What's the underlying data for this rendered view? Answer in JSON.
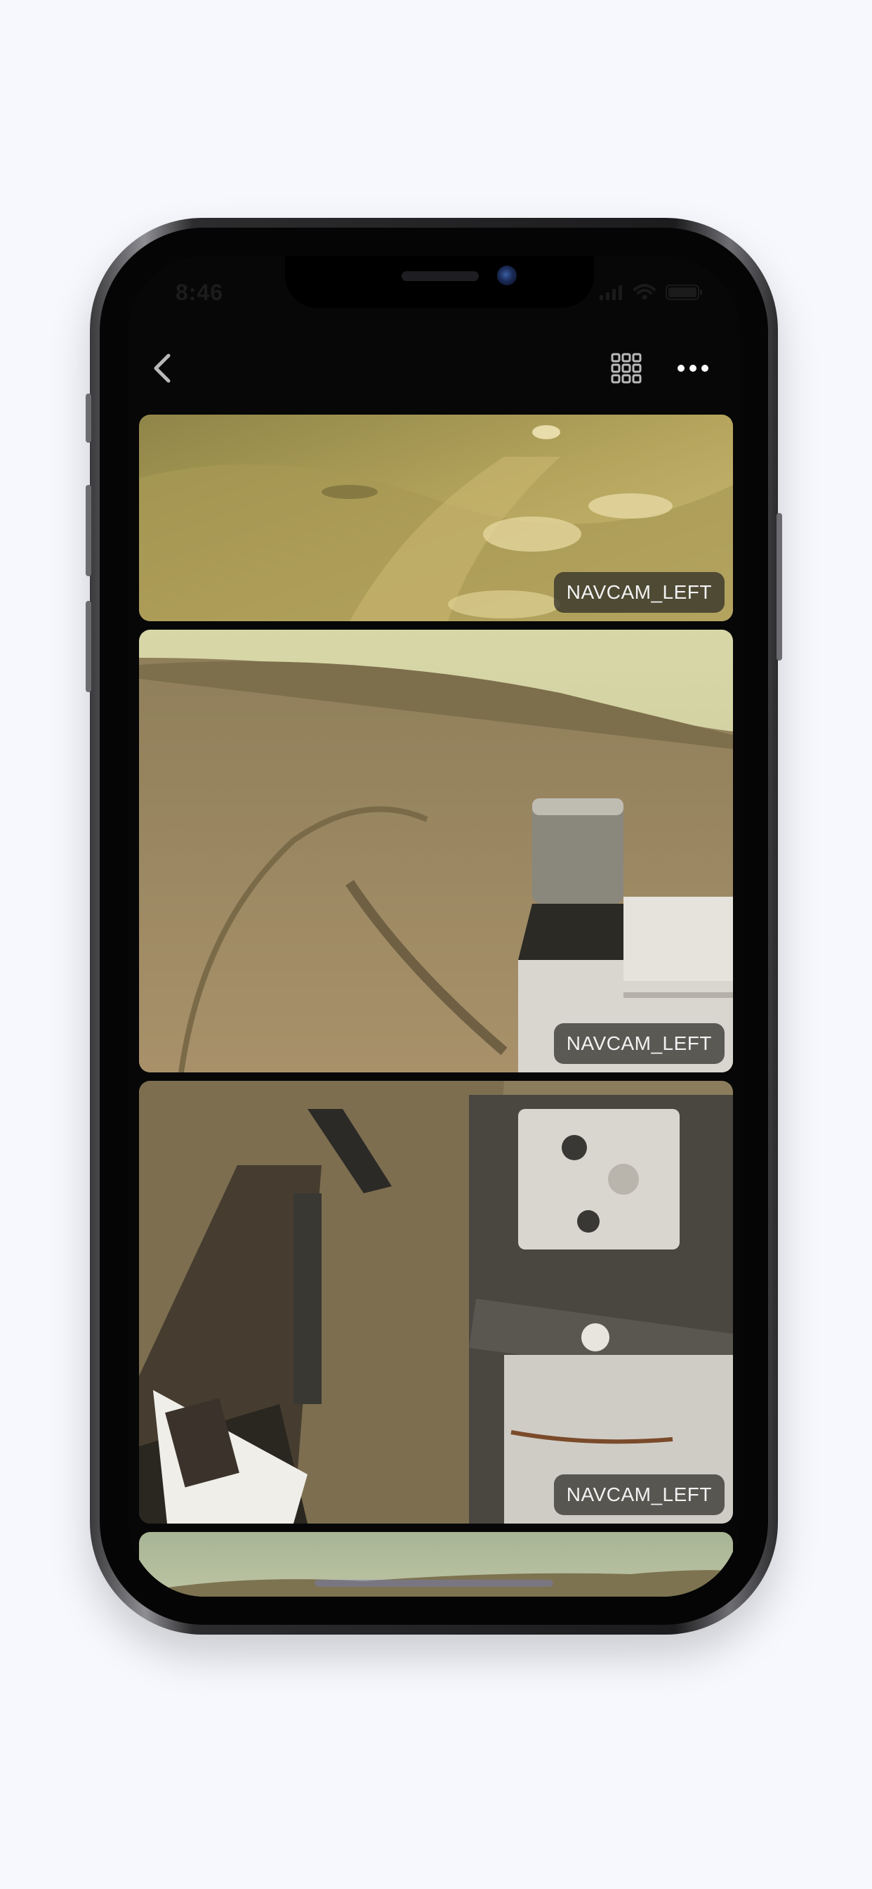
{
  "status_bar": {
    "time": "8:46"
  },
  "toolbar": {
    "back_icon": "chevron-left-icon",
    "grid_icon": "grid-icon",
    "more_icon": "ellipsis-icon"
  },
  "photos": [
    {
      "camera": "NAVCAM_LEFT"
    },
    {
      "camera": "NAVCAM_LEFT"
    },
    {
      "camera": "NAVCAM_LEFT"
    },
    {
      "camera": ""
    }
  ],
  "colors": {
    "page_background": "#f6f8fd",
    "screen_background": "#070707",
    "icon_color": "#b9b9b9"
  }
}
